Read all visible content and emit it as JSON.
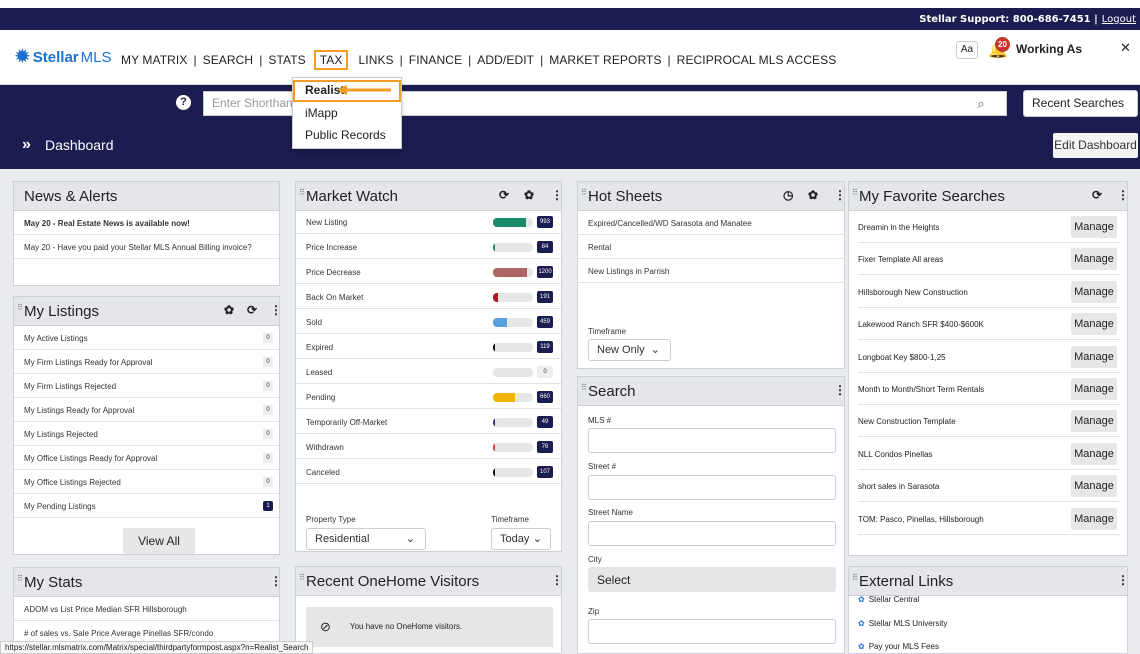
{
  "support": {
    "text": "Stellar Support: 800-686-7451  |",
    "logout": "Logout"
  },
  "brand": {
    "part1": "Stellar",
    "part2": "MLS"
  },
  "menu": [
    "MY MATRIX",
    "SEARCH",
    "STATS",
    "TAX",
    "LINKS",
    "FINANCE",
    "ADD/EDIT",
    "MARKET REPORTS",
    "RECIPROCAL MLS ACCESS"
  ],
  "user": {
    "aa": "Aa",
    "notifications": "20",
    "working_as": "Working As"
  },
  "tax_dropdown": [
    "Realist",
    "iMapp",
    "Public Records"
  ],
  "search": {
    "placeholder": "Enter Shorthand",
    "recent": "Recent Searches"
  },
  "dashboard": {
    "title": "Dashboard",
    "edit": "Edit Dashboard"
  },
  "news": {
    "title": "News & Alerts",
    "items": [
      "May 20 - Real Estate News is available now!",
      "May 20 - Have you paid your Stellar MLS Annual Billing invoice?"
    ]
  },
  "listings": {
    "title": "My Listings",
    "view_all": "View All",
    "items": [
      {
        "label": "My Active Listings",
        "count": "0"
      },
      {
        "label": "My Firm Listings Ready for Approval",
        "count": "0"
      },
      {
        "label": "My Firm Listings Rejected",
        "count": "0"
      },
      {
        "label": "My Listings Ready for Approval",
        "count": "0"
      },
      {
        "label": "My Listings Rejected",
        "count": "0"
      },
      {
        "label": "My Office Listings Ready for Approval",
        "count": "0"
      },
      {
        "label": "My Office Listings Rejected",
        "count": "0"
      },
      {
        "label": "My Pending Listings",
        "count": "1"
      }
    ]
  },
  "stats": {
    "title": "My Stats",
    "items": [
      "ADOM vs List Price Median SFR Hillsborough",
      "# of sales vs. Sale Price Average Pinellas SFR/condo"
    ]
  },
  "market_watch": {
    "title": "Market Watch",
    "property_type_label": "Property Type",
    "property_type": "Residential",
    "timeframe_label": "Timeframe",
    "timeframe": "Today",
    "items": [
      {
        "label": "New Listing",
        "count": "993",
        "fill": 0.82,
        "color": "#1a8a6a"
      },
      {
        "label": "Price Increase",
        "count": "84",
        "fill": 0.06,
        "color": "#1a8a6a"
      },
      {
        "label": "Price Decrease",
        "count": "1200",
        "fill": 0.85,
        "color": "#b06565"
      },
      {
        "label": "Back On Market",
        "count": "191",
        "fill": 0.12,
        "color": "#aa1d1d"
      },
      {
        "label": "Sold",
        "count": "459",
        "fill": 0.35,
        "color": "#5aa0e0"
      },
      {
        "label": "Expired",
        "count": "119",
        "fill": 0.06,
        "color": "#111111"
      },
      {
        "label": "Leased",
        "count": "0",
        "fill": 0.0,
        "color": "#cccccc"
      },
      {
        "label": "Pending",
        "count": "660",
        "fill": 0.55,
        "color": "#f0b400"
      },
      {
        "label": "Temporarily Off-Market",
        "count": "49",
        "fill": 0.04,
        "color": "#3a3a8a"
      },
      {
        "label": "Withdrawn",
        "count": "76",
        "fill": 0.06,
        "color": "#d04040"
      },
      {
        "label": "Canceled",
        "count": "107",
        "fill": 0.06,
        "color": "#111111"
      }
    ]
  },
  "onehome": {
    "title": "Recent OneHome Visitors",
    "empty": "You have no OneHome visitors."
  },
  "hot_sheets": {
    "title": "Hot Sheets",
    "items": [
      "Expired/Cancelled/WD Sarasota and Manatee",
      "Rental",
      "New Listings in Parrish"
    ],
    "timeframe_label": "Timeframe",
    "timeframe": "New Only"
  },
  "search_panel": {
    "title": "Search",
    "fields": [
      "MLS #",
      "Street #",
      "Street Name",
      "City",
      "Zip"
    ],
    "city_select": "Select"
  },
  "favorites": {
    "title": "My Favorite Searches",
    "manage": "Manage",
    "items": [
      "Dreamin in the Heights",
      "Fixer Template All areas",
      "Hillsborough New Construction",
      "Lakewood Ranch SFR $400-$600K",
      "Longboat Key $800-1,25",
      "Month to Month/Short Term Rentals",
      "New Construction Template",
      "NLL Condos Pinellas",
      "short sales in Sarasota",
      "TOM: Pasco, Pinellas, Hillsborough"
    ]
  },
  "external": {
    "title": "External Links",
    "items": [
      "Stellar Central",
      "Stellar MLS University",
      "Pay your MLS Fees"
    ]
  },
  "status_url": "https://stellar.mlsmatrix.com/Matrix/special/thirdpartyformpost.aspx?n=Realist_Search"
}
